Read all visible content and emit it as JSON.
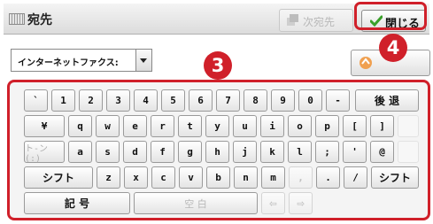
{
  "header": {
    "title": "宛先",
    "dest_button": "次宛先",
    "close_button": "閉じる"
  },
  "mode_select": {
    "value": "インターネットファクス:"
  },
  "side_button": {
    "label": "ー"
  },
  "keyboard": {
    "row1": [
      "`",
      "1",
      "2",
      "3",
      "4",
      "5",
      "6",
      "7",
      "8",
      "9",
      "0",
      "-"
    ],
    "backspace": "後 退",
    "row2": [
      "¥",
      "q",
      "w",
      "e",
      "r",
      "t",
      "y",
      "u",
      "i",
      "o",
      "p",
      "[",
      "]"
    ],
    "tone": "ト-ン(:)",
    "row3": [
      "a",
      "s",
      "d",
      "f",
      "g",
      "h",
      "j",
      "k",
      "l",
      ";",
      "'",
      "@"
    ],
    "shift_left": "シフト",
    "row4": [
      "z",
      "x",
      "c",
      "v",
      "b",
      "n",
      "m",
      ",",
      ".",
      "/"
    ],
    "shift_right": "シフト",
    "symbols": "記 号",
    "space": "空 白",
    "arrow_left": "⇦",
    "arrow_right": "⇨"
  },
  "callouts": {
    "keyboard": "3",
    "close": "4"
  },
  "colors": {
    "highlight": "#d0202a",
    "check": "#3aa02a"
  }
}
